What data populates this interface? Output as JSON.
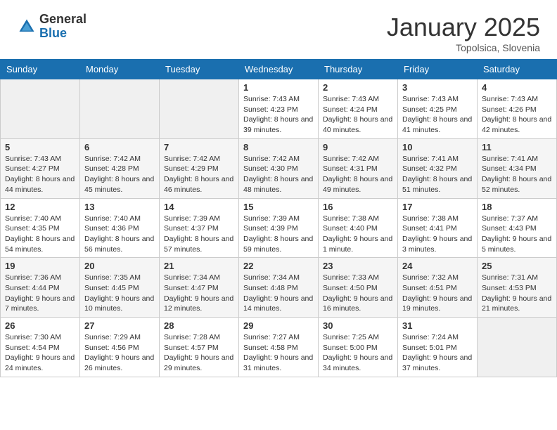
{
  "header": {
    "logo_general": "General",
    "logo_blue": "Blue",
    "title": "January 2025",
    "subtitle": "Topolsica, Slovenia"
  },
  "weekdays": [
    "Sunday",
    "Monday",
    "Tuesday",
    "Wednesday",
    "Thursday",
    "Friday",
    "Saturday"
  ],
  "weeks": [
    [
      {
        "day": "",
        "sunrise": "",
        "sunset": "",
        "daylight": ""
      },
      {
        "day": "",
        "sunrise": "",
        "sunset": "",
        "daylight": ""
      },
      {
        "day": "",
        "sunrise": "",
        "sunset": "",
        "daylight": ""
      },
      {
        "day": "1",
        "sunrise": "Sunrise: 7:43 AM",
        "sunset": "Sunset: 4:23 PM",
        "daylight": "Daylight: 8 hours and 39 minutes."
      },
      {
        "day": "2",
        "sunrise": "Sunrise: 7:43 AM",
        "sunset": "Sunset: 4:24 PM",
        "daylight": "Daylight: 8 hours and 40 minutes."
      },
      {
        "day": "3",
        "sunrise": "Sunrise: 7:43 AM",
        "sunset": "Sunset: 4:25 PM",
        "daylight": "Daylight: 8 hours and 41 minutes."
      },
      {
        "day": "4",
        "sunrise": "Sunrise: 7:43 AM",
        "sunset": "Sunset: 4:26 PM",
        "daylight": "Daylight: 8 hours and 42 minutes."
      }
    ],
    [
      {
        "day": "5",
        "sunrise": "Sunrise: 7:43 AM",
        "sunset": "Sunset: 4:27 PM",
        "daylight": "Daylight: 8 hours and 44 minutes."
      },
      {
        "day": "6",
        "sunrise": "Sunrise: 7:42 AM",
        "sunset": "Sunset: 4:28 PM",
        "daylight": "Daylight: 8 hours and 45 minutes."
      },
      {
        "day": "7",
        "sunrise": "Sunrise: 7:42 AM",
        "sunset": "Sunset: 4:29 PM",
        "daylight": "Daylight: 8 hours and 46 minutes."
      },
      {
        "day": "8",
        "sunrise": "Sunrise: 7:42 AM",
        "sunset": "Sunset: 4:30 PM",
        "daylight": "Daylight: 8 hours and 48 minutes."
      },
      {
        "day": "9",
        "sunrise": "Sunrise: 7:42 AM",
        "sunset": "Sunset: 4:31 PM",
        "daylight": "Daylight: 8 hours and 49 minutes."
      },
      {
        "day": "10",
        "sunrise": "Sunrise: 7:41 AM",
        "sunset": "Sunset: 4:32 PM",
        "daylight": "Daylight: 8 hours and 51 minutes."
      },
      {
        "day": "11",
        "sunrise": "Sunrise: 7:41 AM",
        "sunset": "Sunset: 4:34 PM",
        "daylight": "Daylight: 8 hours and 52 minutes."
      }
    ],
    [
      {
        "day": "12",
        "sunrise": "Sunrise: 7:40 AM",
        "sunset": "Sunset: 4:35 PM",
        "daylight": "Daylight: 8 hours and 54 minutes."
      },
      {
        "day": "13",
        "sunrise": "Sunrise: 7:40 AM",
        "sunset": "Sunset: 4:36 PM",
        "daylight": "Daylight: 8 hours and 56 minutes."
      },
      {
        "day": "14",
        "sunrise": "Sunrise: 7:39 AM",
        "sunset": "Sunset: 4:37 PM",
        "daylight": "Daylight: 8 hours and 57 minutes."
      },
      {
        "day": "15",
        "sunrise": "Sunrise: 7:39 AM",
        "sunset": "Sunset: 4:39 PM",
        "daylight": "Daylight: 8 hours and 59 minutes."
      },
      {
        "day": "16",
        "sunrise": "Sunrise: 7:38 AM",
        "sunset": "Sunset: 4:40 PM",
        "daylight": "Daylight: 9 hours and 1 minute."
      },
      {
        "day": "17",
        "sunrise": "Sunrise: 7:38 AM",
        "sunset": "Sunset: 4:41 PM",
        "daylight": "Daylight: 9 hours and 3 minutes."
      },
      {
        "day": "18",
        "sunrise": "Sunrise: 7:37 AM",
        "sunset": "Sunset: 4:43 PM",
        "daylight": "Daylight: 9 hours and 5 minutes."
      }
    ],
    [
      {
        "day": "19",
        "sunrise": "Sunrise: 7:36 AM",
        "sunset": "Sunset: 4:44 PM",
        "daylight": "Daylight: 9 hours and 7 minutes."
      },
      {
        "day": "20",
        "sunrise": "Sunrise: 7:35 AM",
        "sunset": "Sunset: 4:45 PM",
        "daylight": "Daylight: 9 hours and 10 minutes."
      },
      {
        "day": "21",
        "sunrise": "Sunrise: 7:34 AM",
        "sunset": "Sunset: 4:47 PM",
        "daylight": "Daylight: 9 hours and 12 minutes."
      },
      {
        "day": "22",
        "sunrise": "Sunrise: 7:34 AM",
        "sunset": "Sunset: 4:48 PM",
        "daylight": "Daylight: 9 hours and 14 minutes."
      },
      {
        "day": "23",
        "sunrise": "Sunrise: 7:33 AM",
        "sunset": "Sunset: 4:50 PM",
        "daylight": "Daylight: 9 hours and 16 minutes."
      },
      {
        "day": "24",
        "sunrise": "Sunrise: 7:32 AM",
        "sunset": "Sunset: 4:51 PM",
        "daylight": "Daylight: 9 hours and 19 minutes."
      },
      {
        "day": "25",
        "sunrise": "Sunrise: 7:31 AM",
        "sunset": "Sunset: 4:53 PM",
        "daylight": "Daylight: 9 hours and 21 minutes."
      }
    ],
    [
      {
        "day": "26",
        "sunrise": "Sunrise: 7:30 AM",
        "sunset": "Sunset: 4:54 PM",
        "daylight": "Daylight: 9 hours and 24 minutes."
      },
      {
        "day": "27",
        "sunrise": "Sunrise: 7:29 AM",
        "sunset": "Sunset: 4:56 PM",
        "daylight": "Daylight: 9 hours and 26 minutes."
      },
      {
        "day": "28",
        "sunrise": "Sunrise: 7:28 AM",
        "sunset": "Sunset: 4:57 PM",
        "daylight": "Daylight: 9 hours and 29 minutes."
      },
      {
        "day": "29",
        "sunrise": "Sunrise: 7:27 AM",
        "sunset": "Sunset: 4:58 PM",
        "daylight": "Daylight: 9 hours and 31 minutes."
      },
      {
        "day": "30",
        "sunrise": "Sunrise: 7:25 AM",
        "sunset": "Sunset: 5:00 PM",
        "daylight": "Daylight: 9 hours and 34 minutes."
      },
      {
        "day": "31",
        "sunrise": "Sunrise: 7:24 AM",
        "sunset": "Sunset: 5:01 PM",
        "daylight": "Daylight: 9 hours and 37 minutes."
      },
      {
        "day": "",
        "sunrise": "",
        "sunset": "",
        "daylight": ""
      }
    ]
  ]
}
